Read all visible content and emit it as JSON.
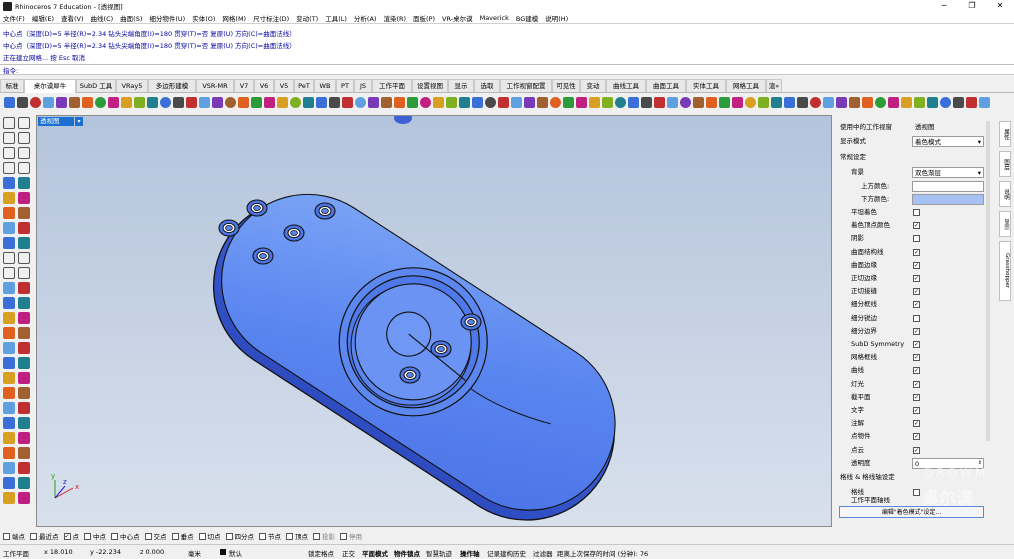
{
  "window": {
    "title": "Rhinoceros 7 Education - [透视图]",
    "min": "─",
    "max": "❐",
    "close": "✕"
  },
  "menu": [
    "文件(F)",
    "编辑(E)",
    "查看(V)",
    "曲线(C)",
    "曲面(S)",
    "细分物件(U)",
    "实体(O)",
    "网格(M)",
    "尺寸标注(D)",
    "变动(T)",
    "工具(L)",
    "分析(A)",
    "渲染(R)",
    "面板(P)",
    "VR-桌尔谟",
    "Maverick",
    "BG建模",
    "说明(H)"
  ],
  "command_history": [
    "中心点（深度(D)=5  半径(R)=2.34  钻头尖端角度(I)=180  贯穿(T)=否  复原(U)  方向(C)=曲面法线）",
    "中心点（深度(D)=5  半径(R)=2.34  钻头尖端角度(I)=180  贯穿(T)=否  复原(U)  方向(C)=曲面法线）",
    "正在建立网格... 按 Esc 取消"
  ],
  "command_prompt": "指令:",
  "toolbar_tabs": [
    "标准",
    "桌尔谟犀牛",
    "SubD 工具",
    "VRay5",
    "多边形建模",
    "VSR-MR",
    "V7",
    "V6",
    "V5",
    "PeT",
    "WB",
    "PT",
    "JS",
    "工作平面",
    "设置视图",
    "显示",
    "选取",
    "工作视窗配置",
    "可见性",
    "变动",
    "曲线工具",
    "曲面工具",
    "实体工具",
    "网格工具",
    "渲»"
  ],
  "viewport": {
    "label": "透视图",
    "dropdown": "▾",
    "axis_x": "x",
    "axis_y": "y",
    "axis_z": "z"
  },
  "panel": {
    "viewport_label": "使用中的工作视窗",
    "viewport_value": "透视图",
    "display_mode_label": "显示模式",
    "display_mode_value": "着色模式",
    "general_header": "常规设定",
    "background_label": "背景",
    "background_value": "双色渐层",
    "top_color_label": "上方颜色:",
    "bottom_color_label": "下方颜色:",
    "bottom_color": "#a7c1f2",
    "items": [
      {
        "label": "平坦着色",
        "checked": false
      },
      {
        "label": "着色顶点颜色",
        "checked": true
      },
      {
        "label": "阴影",
        "checked": false
      },
      {
        "label": "曲面结构线",
        "checked": true
      },
      {
        "label": "曲面边缘",
        "checked": true
      },
      {
        "label": "正切边缘",
        "checked": true
      },
      {
        "label": "正切接缝",
        "checked": true
      },
      {
        "label": "细分框线",
        "checked": true
      },
      {
        "label": "细分锐边",
        "checked": false
      },
      {
        "label": "细分边界",
        "checked": true
      },
      {
        "label": "SubD Symmetry",
        "checked": true
      },
      {
        "label": "网格框线",
        "checked": true
      },
      {
        "label": "曲线",
        "checked": true
      },
      {
        "label": "灯光",
        "checked": true
      },
      {
        "label": "截平面",
        "checked": true
      },
      {
        "label": "文字",
        "checked": true
      },
      {
        "label": "注解",
        "checked": true
      },
      {
        "label": "点物件",
        "checked": true
      },
      {
        "label": "点云",
        "checked": true
      }
    ],
    "transparency_label": "透明度",
    "transparency_value": "0",
    "gridlines_header": "格线 & 格线轴设定",
    "grid_label": "格线",
    "workplane_axes_label": "工作平面轴线",
    "edit_button": "编辑\"着色模式\"设定..."
  },
  "right_tabs": [
    "属性",
    "图层",
    "说明",
    "显示",
    "Grasshopper"
  ],
  "snaps": [
    {
      "label": "端点",
      "checked": false
    },
    {
      "label": "最近点",
      "checked": false
    },
    {
      "label": "点",
      "checked": true
    },
    {
      "label": "中点",
      "checked": false
    },
    {
      "label": "中心点",
      "checked": false
    },
    {
      "label": "交点",
      "checked": false
    },
    {
      "label": "垂点",
      "checked": false
    },
    {
      "label": "切点",
      "checked": false
    },
    {
      "label": "四分点",
      "checked": false
    },
    {
      "label": "节点",
      "checked": false
    },
    {
      "label": "顶点",
      "checked": false
    },
    {
      "label": "投影",
      "checked": false
    },
    {
      "label": "停用",
      "checked": false
    }
  ],
  "status": {
    "cplane": "工作平面",
    "x": "x 18.010",
    "y": "y -22.234",
    "z": "z 0.000",
    "unit": "毫米",
    "layer": "默认",
    "grid_snap": "锁定格点",
    "ortho": "正交",
    "planar": "平面模式",
    "osnap": "物件锁点",
    "smarttrack": "智慧轨迹",
    "gumball": "操作轴",
    "history": "记录建构历史",
    "filter": "过滤器",
    "autosave": "距离上次保存的时间 (分钟): 76"
  },
  "watermark": {
    "line1": "DROWM",
    "line2": "桌尔谟"
  }
}
